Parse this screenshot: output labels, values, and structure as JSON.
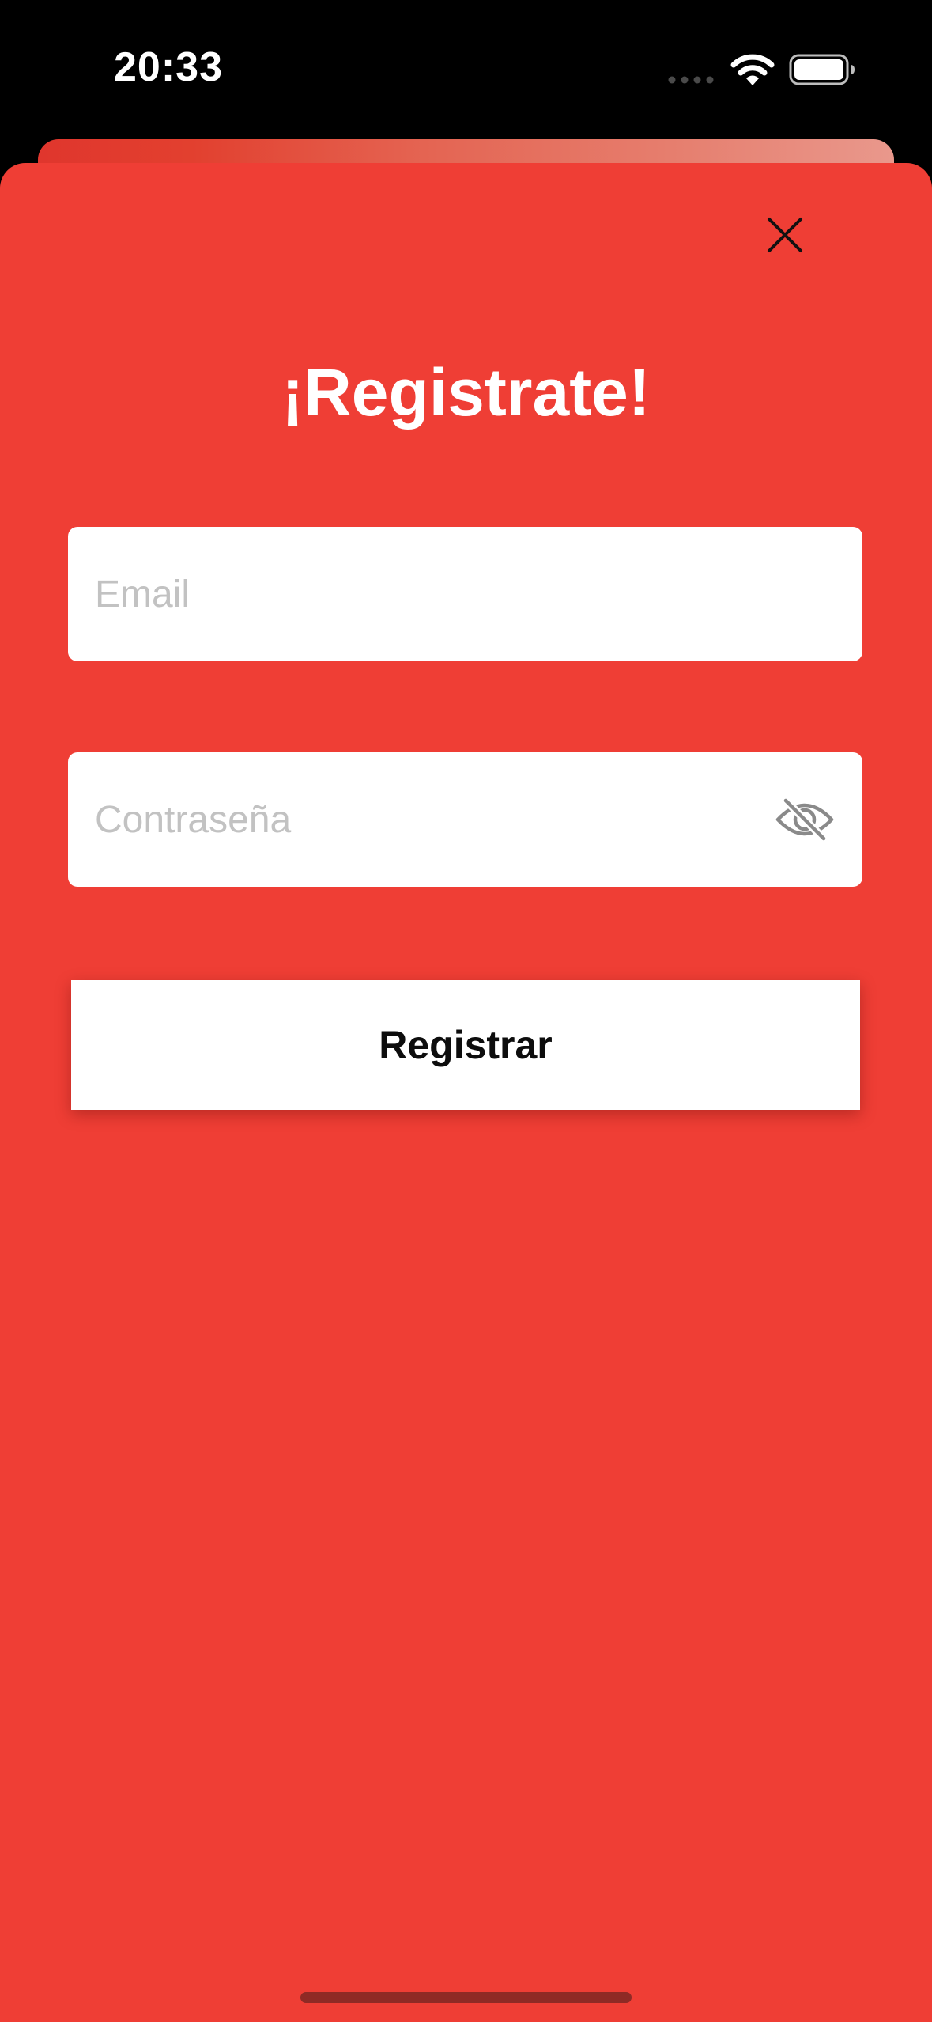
{
  "status_bar": {
    "time": "20:33",
    "icons": [
      "signal-dots-icon",
      "wifi-icon",
      "battery-icon"
    ]
  },
  "colors": {
    "sheet_background": "#ef3e35",
    "title": "#ffffff",
    "field_background": "#ffffff",
    "placeholder": "#c2c2c2",
    "button_background": "#ffffff",
    "button_text": "#0d0d0d"
  },
  "sheet": {
    "close_icon": "close-icon",
    "title": "¡Registrate!",
    "email": {
      "value": "",
      "placeholder": "Email"
    },
    "password": {
      "value": "",
      "placeholder": "Contraseña",
      "toggle_icon": "eye-slash-icon"
    },
    "submit_label": "Registrar"
  }
}
